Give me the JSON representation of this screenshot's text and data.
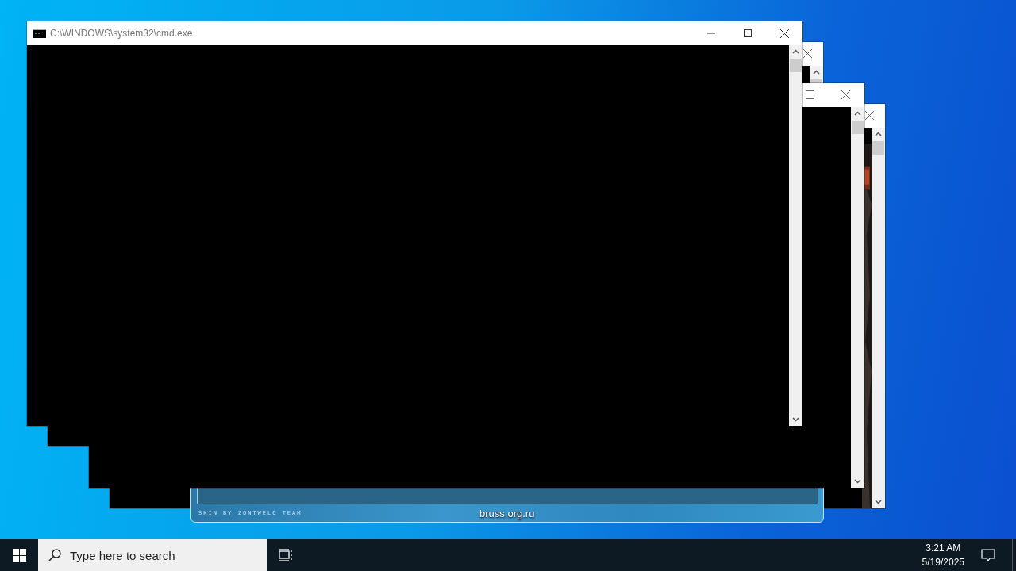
{
  "windows": [
    {
      "kind": "console"
    },
    {
      "kind": "skin",
      "credit": "SKIN BY ZONTWELG TEAM",
      "site": "bruss.org.ru"
    },
    {
      "kind": "console"
    },
    {
      "kind": "console"
    },
    {
      "kind": "console",
      "title": "C:\\WINDOWS\\system32\\cmd.exe"
    }
  ],
  "taskbar": {
    "search": {
      "placeholder": "Type here to search"
    },
    "time": "3:21 AM",
    "date": "5/19/2025"
  }
}
